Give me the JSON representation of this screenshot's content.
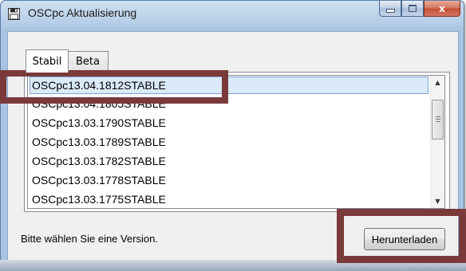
{
  "window": {
    "title": "OSCpc Aktualisierung",
    "icon": "floppy-disk-icon",
    "caption_buttons": {
      "minimize_icon": "minimize-icon",
      "maximize_icon": "maximize-icon",
      "close_label": "x"
    }
  },
  "tabs": [
    {
      "label": "Stabil",
      "active": true
    },
    {
      "label": "Beta",
      "active": false
    }
  ],
  "versions": [
    "OSCpc13.04.1812STABLE",
    "OSCpc13.04.1805STABLE",
    "OSCpc13.03.1790STABLE",
    "OSCpc13.03.1789STABLE",
    "OSCpc13.03.1782STABLE",
    "OSCpc13.03.1778STABLE",
    "OSCpc13.03.1775STABLE"
  ],
  "selected_version": "OSCpc13.04.1812STABLE",
  "status_text": "Bitte wählen Sie eine Version.",
  "download_button": "Herunterladen",
  "colors": {
    "highlight_frame": "#7a3a3a",
    "selection_bg": "#dbeaf9"
  }
}
